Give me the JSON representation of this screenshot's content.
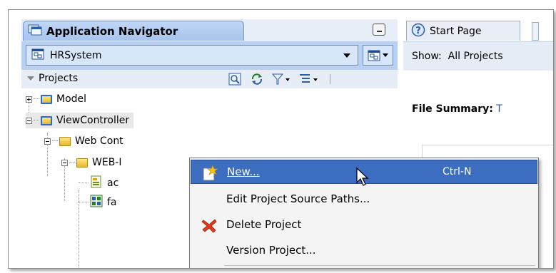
{
  "navigator": {
    "title": "Application Navigator",
    "application": "HRSystem",
    "projects_label": "Projects"
  },
  "tree": {
    "items": [
      {
        "label": "Model"
      },
      {
        "label": "ViewController"
      },
      {
        "label": "Web Cont"
      },
      {
        "label": "WEB-I"
      },
      {
        "label": "ac"
      },
      {
        "label": "fa"
      }
    ]
  },
  "right": {
    "tab_label": "Start Page",
    "show_prefix": "Show:",
    "show_value": "All Projects",
    "file_summary_label": "File Summary:",
    "file_summary_value": "T"
  },
  "context_menu": {
    "items": [
      {
        "label": "New...",
        "shortcut": "Ctrl-N",
        "icon": "new-star-icon"
      },
      {
        "label": "Edit Project Source Paths...",
        "shortcut": "",
        "icon": ""
      },
      {
        "label": "Delete Project",
        "shortcut": "",
        "icon": "red-x-icon"
      },
      {
        "label": "Version Project...",
        "shortcut": "",
        "icon": ""
      }
    ]
  },
  "colors": {
    "selection": "#3c6dbf",
    "header_blue": "#b9d0f0",
    "delete_red": "#e03a1a"
  }
}
